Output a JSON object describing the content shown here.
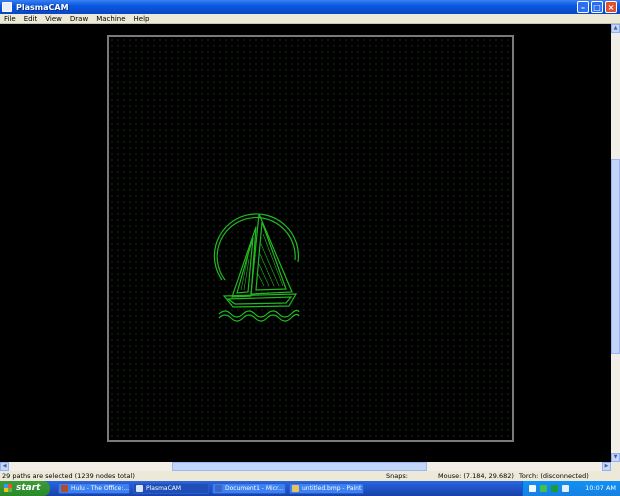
{
  "window": {
    "title": "PlasmaCAM"
  },
  "menu": [
    "File",
    "Edit",
    "View",
    "Draw",
    "Machine",
    "Help"
  ],
  "status": {
    "selection": "29 paths are selected (1239 nodes total)",
    "snaps": "Snaps:",
    "mouse": "Mouse: (7.184, 29.682)",
    "torch": "Torch: (disconnected)"
  },
  "taskbar": {
    "start": "start",
    "tasks": [
      {
        "label": "Hulu - The Office:...",
        "icon_color": "#b34a2a"
      },
      {
        "label": "PlasmaCAM",
        "icon_color": "#dbe6fb"
      },
      {
        "label": "Document1 - Micr...",
        "icon_color": "#3b64c9"
      },
      {
        "label": "untitled.bmp - Paint",
        "icon_color": "#e6c35a"
      }
    ],
    "clock": "10:07 AM"
  },
  "colors": {
    "drawing": "#22b822",
    "grid_border": "#7a7a7a"
  }
}
